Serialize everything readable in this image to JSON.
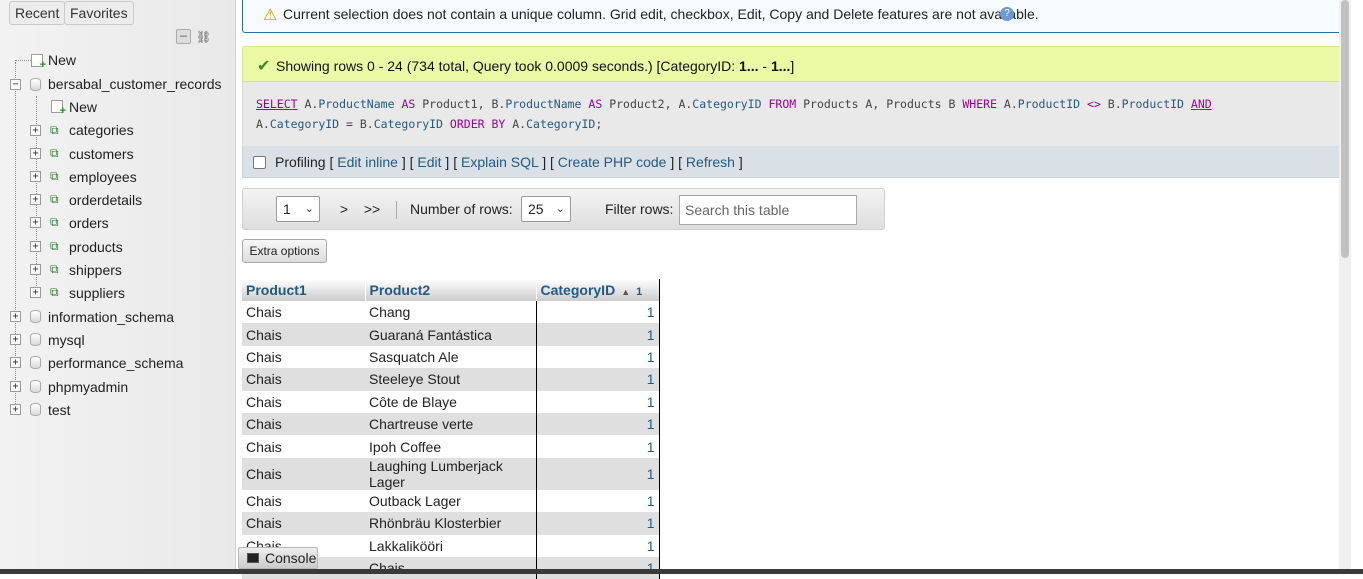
{
  "sidebar": {
    "recent_label": "Recent",
    "favorites_label": "Favorites",
    "tree": {
      "root_new": "New",
      "current_db": "bersabal_customer_records",
      "db_new": "New",
      "tables": [
        "categories",
        "customers",
        "employees",
        "orderdetails",
        "orders",
        "products",
        "shippers",
        "suppliers"
      ],
      "other_dbs": [
        "information_schema",
        "mysql",
        "performance_schema",
        "phpmyadmin",
        "test"
      ]
    }
  },
  "warning": {
    "text": "Current selection does not contain a unique column. Grid edit, checkbox, Edit, Copy and Delete features are not available."
  },
  "success": {
    "text_prefix": "Showing rows 0 - 24 (734 total, Query took 0.0009 seconds.) [CategoryID: ",
    "range_start": "1...",
    "range_sep": " - ",
    "range_end": "1...",
    "text_suffix": "]"
  },
  "sql": {
    "line1": "SELECT A.ProductName AS Product1, B.ProductName AS Product2, A.CategoryID FROM Products A, Products B WHERE A.ProductID <> B.ProductID AND",
    "line2": "A.CategoryID = B.CategoryID ORDER BY A.CategoryID;"
  },
  "profiling": {
    "label": "Profiling",
    "links": [
      "Edit inline",
      "Edit",
      "Explain SQL",
      "Create PHP code",
      "Refresh"
    ]
  },
  "navigation": {
    "page_value": "1",
    "next_label": ">",
    "last_label": ">>",
    "rows_label": "Number of rows:",
    "rows_value": "25",
    "filter_label": "Filter rows:",
    "filter_placeholder": "Search this table"
  },
  "extra_options_label": "Extra options",
  "results": {
    "columns": [
      "Product1",
      "Product2",
      "CategoryID"
    ],
    "sort_index": "1",
    "rows": [
      [
        "Chais",
        "Chang",
        "1"
      ],
      [
        "Chais",
        "Guaraná Fantástica",
        "1"
      ],
      [
        "Chais",
        "Sasquatch Ale",
        "1"
      ],
      [
        "Chais",
        "Steeleye Stout",
        "1"
      ],
      [
        "Chais",
        "Côte de Blaye",
        "1"
      ],
      [
        "Chais",
        "Chartreuse verte",
        "1"
      ],
      [
        "Chais",
        "Ipoh Coffee",
        "1"
      ],
      [
        "Chais",
        "Laughing Lumberjack Lager",
        "1"
      ],
      [
        "Chais",
        "Outback Lager",
        "1"
      ],
      [
        "Chais",
        "Rhönbräu Klosterbier",
        "1"
      ],
      [
        "Chais",
        "Lakkalikööri",
        "1"
      ],
      [
        "Chais",
        "Chais",
        "1"
      ]
    ]
  },
  "console_label": "Console"
}
